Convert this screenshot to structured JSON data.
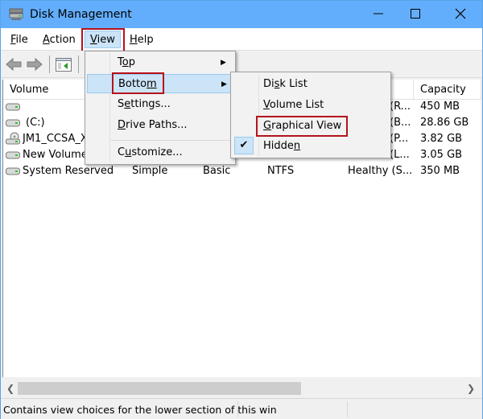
{
  "window": {
    "title": "Disk Management",
    "icon": "disk-management-icon",
    "controls": [
      "minimize-icon",
      "maximize-icon",
      "close-icon"
    ]
  },
  "menubar": {
    "items": [
      {
        "label": "File",
        "accel": "F"
      },
      {
        "label": "Action",
        "accel": "A"
      },
      {
        "label": "View",
        "accel": "V",
        "active": true
      },
      {
        "label": "Help",
        "accel": "H"
      }
    ]
  },
  "toolbar": {
    "buttons": [
      "back-arrow-icon",
      "forward-arrow-icon",
      "show-hide-console-tree-icon"
    ]
  },
  "table": {
    "columns": [
      "Volume",
      "",
      "",
      "",
      "",
      "Capacity"
    ],
    "rows": [
      {
        "volume": "",
        "layout": "",
        "type": "",
        "fs": "",
        "status": "(R...",
        "capacity": "450 MB",
        "icon": "disk-icon"
      },
      {
        "volume": "(C:)",
        "layout": "",
        "type": "",
        "fs": "",
        "status": "(B...",
        "capacity": "28.86 GB",
        "icon": "disk-icon"
      },
      {
        "volume": "JM1_CCSA_X",
        "layout": "",
        "type": "",
        "fs": "",
        "status": "(P...",
        "capacity": "3.82 GB",
        "icon": "cd-drive-icon"
      },
      {
        "volume": "New Volume",
        "layout": "",
        "type": "",
        "fs": "",
        "status": "(L...",
        "capacity": "3.05 GB",
        "icon": "disk-icon"
      },
      {
        "volume": "System Reserved",
        "layout": "Simple",
        "type": "Basic",
        "fs": "NTFS",
        "status": "Healthy (S...",
        "capacity": "350 MB",
        "icon": "disk-icon"
      }
    ]
  },
  "view_menu": {
    "items": [
      {
        "pre": "T",
        "accel": "o",
        "post": "p",
        "submenu": true
      },
      {
        "pre": "Botto",
        "accel": "m",
        "post": "",
        "submenu": true,
        "highlighted": true
      },
      {
        "pre": "S",
        "accel": "e",
        "post": "ttings...",
        "submenu": false
      },
      {
        "pre": "",
        "accel": "D",
        "post": "rive Paths...",
        "submenu": false
      },
      {
        "pre": "C",
        "accel": "u",
        "post": "stomize...",
        "submenu": false
      }
    ]
  },
  "bottom_submenu": {
    "items": [
      {
        "pre": "Di",
        "accel": "s",
        "post": "k List",
        "checked": false
      },
      {
        "pre": "",
        "accel": "V",
        "post": "olume List",
        "checked": false
      },
      {
        "pre": "",
        "accel": "G",
        "post": "raphical View",
        "checked": false,
        "callout": true
      },
      {
        "pre": "Hidde",
        "accel": "n",
        "post": "",
        "checked": true
      }
    ]
  },
  "statusbar": {
    "text": "Contains view choices for the lower section of this win"
  },
  "colors": {
    "titlebar": "#63aefc",
    "highlight": "#cce4f7",
    "callout_red": "#b5121b"
  }
}
